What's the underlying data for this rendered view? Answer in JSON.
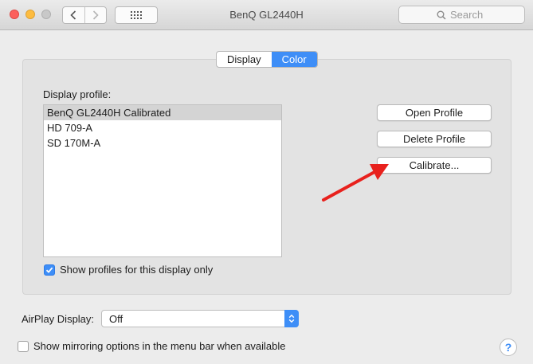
{
  "window": {
    "title": "BenQ GL2440H"
  },
  "toolbar": {
    "back_icon": "chevron-left-icon",
    "forward_icon": "chevron-right-icon",
    "grid_icon": "grid-icon",
    "search_placeholder": "Search"
  },
  "tabs": [
    {
      "label": "Display",
      "active": false
    },
    {
      "label": "Color",
      "active": true
    }
  ],
  "profiles": {
    "label": "Display profile:",
    "items": [
      "BenQ GL2440H Calibrated",
      "HD 709-A",
      "SD 170M-A"
    ],
    "selected_index": 0
  },
  "buttons": {
    "open": "Open Profile",
    "delete": "Delete Profile",
    "calibrate": "Calibrate..."
  },
  "show_profiles_checkbox": {
    "label": "Show profiles for this display only",
    "checked": true
  },
  "airplay": {
    "label": "AirPlay Display:",
    "value": "Off"
  },
  "mirroring_checkbox": {
    "label": "Show mirroring options in the menu bar when available",
    "checked": false
  },
  "help": {
    "label": "?"
  },
  "colors": {
    "accent": "#3e8ef7",
    "annotation": "#e8211d"
  }
}
